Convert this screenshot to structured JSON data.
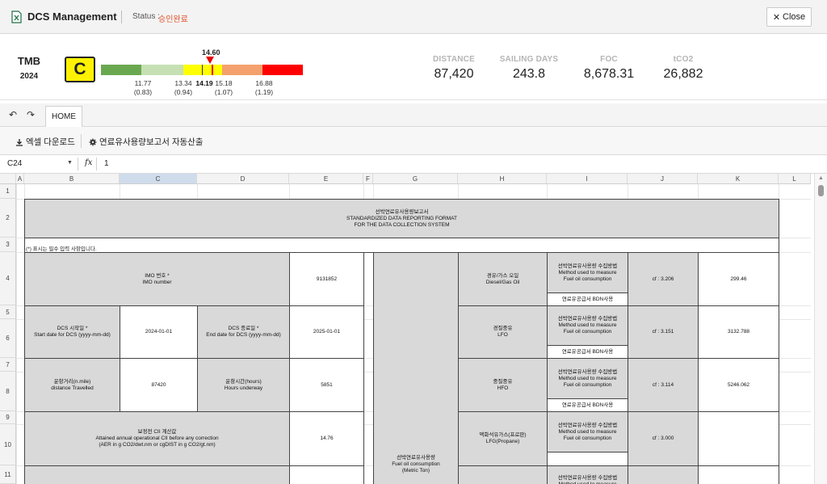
{
  "header": {
    "app_title": "DCS Management",
    "status_label": "Status :",
    "status_value": "승인완료",
    "close_label": "Close"
  },
  "summary": {
    "ship": "TMB",
    "year": "2024",
    "grade": "C",
    "current_value": "14.60",
    "rating_bands": [
      {
        "grade": "A",
        "color": "#6aa84f"
      },
      {
        "grade": "B",
        "color": "#c6e0b4"
      },
      {
        "grade": "C",
        "color": "#ffff00"
      },
      {
        "grade": "D",
        "color": "#f4a16d"
      },
      {
        "grade": "E",
        "color": "#ff0000"
      }
    ],
    "ticks": [
      {
        "value": "11.77",
        "ratio": "(0.83)"
      },
      {
        "value": "13.34",
        "ratio": "(0.94)"
      },
      {
        "value": "14.19",
        "ratio": ""
      },
      {
        "value": "15.18",
        "ratio": "(1.07)"
      },
      {
        "value": "16.88",
        "ratio": "(1.19)"
      }
    ],
    "stats": [
      {
        "label": "DISTANCE",
        "value": "87,420"
      },
      {
        "label": "SAILING DAYS",
        "value": "243.8"
      },
      {
        "label": "FOC",
        "value": "8,678.31"
      },
      {
        "label": "tCO2",
        "value": "26,882"
      }
    ]
  },
  "toolbar": {
    "undo": "↶",
    "redo": "↷",
    "tab_home": "HOME",
    "excel_download": "엑셀 다운로드",
    "auto_report": "연료유사용량보고서 자동산출"
  },
  "formula": {
    "cell_ref": "C24",
    "fx": "fx",
    "value": "1"
  },
  "columns": [
    "A",
    "B",
    "C",
    "D",
    "E",
    "F",
    "G",
    "H",
    "I",
    "J",
    "K",
    "L"
  ],
  "rows": [
    "1",
    "2",
    "3",
    "4",
    "5",
    "6",
    "7",
    "8",
    "9",
    "10",
    "11"
  ],
  "sheet": {
    "title_ko": "선박연료유사용량보고서",
    "title_en1": "STANDARDIZED DATA REPORTING FORMAT",
    "title_en2": "FOR THE DATA COLLECTION SYSTEM",
    "note": "(*) 표시는 필수 입력 사항입니다.",
    "imo_label_ko": "IMO 번호 *",
    "imo_label_en": "IMO number",
    "imo_value": "9131852",
    "start_label_ko": "DCS 시작일 *",
    "start_label_en": "Start date for DCS (yyyy-mm-dd)",
    "start_value": "2024-01-01",
    "end_label_ko": "DCS 종료일 *",
    "end_label_en": "End date for DCS (yyyy-mm-dd)",
    "end_value": "2025-01-01",
    "dist_label_ko": "운항거리(n.mile)",
    "dist_label_en": "distance Travelled",
    "dist_value": "87420",
    "hours_label_ko": "운항시간(hours)",
    "hours_label_en": "Hours underway",
    "hours_value": "5851",
    "cii_label_ko": "보정전 CII 계산값",
    "cii_label_en1": "Attained annual operational CII before any correction",
    "cii_label_en2": "(AER in g CO2/dwt.nm or cgDIST in g CO2/gt.nm)",
    "cii_value": "14.76",
    "fuel_group_ko": "선박연료유사용량",
    "fuel_group_en1": "Fuel oil consumption",
    "fuel_group_en2": "(Metric Ton)",
    "method_ko": "선박연료유사용량 수집방법",
    "method_en1": "Method used to measure",
    "method_en2": "Fuel oil consumption",
    "bdn": "연료유공급서 BDN사용",
    "fuels": [
      {
        "name_ko": "경유/가스 오일",
        "name_en": "Diesel/Gas Oil",
        "cf": "cf : 3.206",
        "value": "299.46"
      },
      {
        "name_ko": "경질중유",
        "name_en": "LFO",
        "cf": "cf : 3.151",
        "value": "3132.788"
      },
      {
        "name_ko": "중질중유",
        "name_en": "HFO",
        "cf": "cf : 3.114",
        "value": "5246.062"
      },
      {
        "name_ko": "액화석유가스(프로판)",
        "name_en": "LFG(Propane)",
        "cf": "cf : 3.000",
        "value": ""
      }
    ]
  }
}
